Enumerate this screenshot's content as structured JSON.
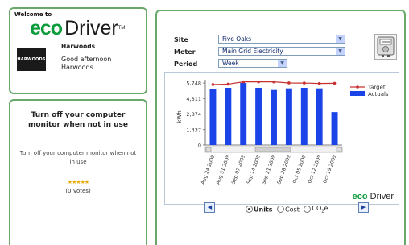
{
  "welcome": {
    "label": "Welcome to",
    "logo_eco": "eco",
    "logo_driver": "Driver",
    "logo_tm": "TM",
    "user_logo_text": "HARWOODS",
    "user_name": "Harwoods",
    "greeting": "Good afternoon Harwoods"
  },
  "tip": {
    "title": "Turn off your computer monitor when not in use",
    "body": "Turn off your computer monitor when not in use",
    "stars": "★★★★★",
    "votes": "(0 Votes)"
  },
  "filters": {
    "site_label": "Site",
    "site_value": "Five Oaks",
    "meter_label": "Meter",
    "meter_value": "Main Grid Electricity",
    "period_label": "Period",
    "period_value": "Week"
  },
  "options": {
    "units": "Units",
    "cost": "Cost",
    "co2": "CO",
    "co2_sub": "2",
    "co2_suffix": "e",
    "selected": "Units"
  },
  "brand": {
    "eco": "eco",
    "driver": "Driver"
  },
  "colors": {
    "panel_border": "#6aa86a",
    "eco_green": "#0a9b3a",
    "bar_blue": "#1a44e8",
    "target_red": "#c83030"
  },
  "chart_data": {
    "type": "bar",
    "categories": [
      "Aug 24 2009",
      "Aug 31 2009",
      "Sep 07 2009",
      "Sep 14 2009",
      "Sep 21 2009",
      "Sep 28 2009",
      "Oct 05 2009",
      "Oct 12 2009",
      "Oct 19 2009"
    ],
    "series": [
      {
        "name": "Actuals",
        "type": "bar",
        "values": [
          5150,
          5300,
          5748,
          5300,
          5100,
          5250,
          5300,
          5250,
          3050
        ]
      },
      {
        "name": "Target",
        "type": "line",
        "values": [
          5600,
          5640,
          5850,
          5850,
          5850,
          5750,
          5740,
          5700,
          5720
        ]
      }
    ],
    "yticks": [
      "5,748",
      "4,311",
      "2,874",
      "1,437",
      "0"
    ],
    "ylabel": "kWh",
    "ylim": [
      0,
      5748
    ],
    "legend": "top-right"
  }
}
